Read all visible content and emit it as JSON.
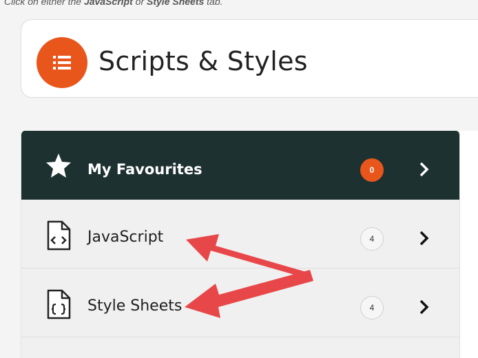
{
  "caption": {
    "prefix": "Click on either the ",
    "js": "JavaScript",
    "mid": " or ",
    "css": "Style Sheets",
    "suffix": " tab."
  },
  "header": {
    "title": "Scripts & Styles",
    "icon": "list-icon",
    "accent": "#e8561b"
  },
  "menu": {
    "favourites": {
      "label": "My Favourites",
      "count": "0",
      "icon": "star-icon",
      "bg": "#1d3130"
    },
    "javascript": {
      "label": "JavaScript",
      "count": "4",
      "icon": "code-file-icon"
    },
    "stylesheets": {
      "label": "Style Sheets",
      "count": "4",
      "icon": "braces-file-icon"
    }
  },
  "annotation": {
    "arrow_color": "#e8474a"
  }
}
